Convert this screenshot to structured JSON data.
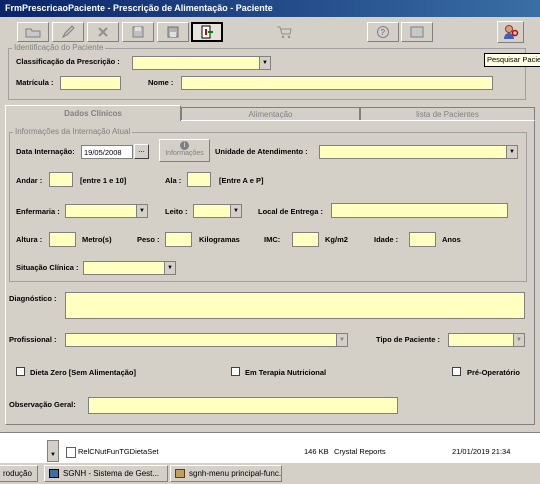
{
  "window": {
    "title": "FrmPrescricaoPaciente - Prescrição de Alimentação - Paciente"
  },
  "toolbar": {
    "tooltip": "Pesquisar Paciente"
  },
  "identificacao": {
    "group_title": "Identificação do Paciente",
    "classificacao_label": "Classificação da Prescrição :",
    "classificacao_value": "",
    "matricula_label": "Matrícula :",
    "matricula_value": "",
    "nome_label": "Nome :",
    "nome_value": ""
  },
  "tabs": [
    {
      "label": "Dados Clínicos"
    },
    {
      "label": "Alimentação"
    },
    {
      "label": "lista de Pacientes"
    }
  ],
  "internacao": {
    "group_title": "Informações da Internação Atual",
    "data_label": "Data Internação:",
    "data_value": "19/05/2008",
    "dots_button": "...",
    "info_button": "Informações",
    "unidade_label": "Unidade de Atendimento :",
    "andar_label": "Andar :",
    "andar_hint": "[entre 1 e 10]",
    "ala_label": "Ala :",
    "ala_hint": "[Entre A e P]",
    "enfermaria_label": "Enfermaria :",
    "leito_label": "Leito :",
    "local_label": "Local de Entrega :",
    "altura_label": "Altura :",
    "altura_unit": "Metro(s)",
    "peso_label": "Peso :",
    "peso_unit": "Kilogramas",
    "imc_label": "IMC:",
    "imc_unit": "Kg/m2",
    "idade_label": "Idade :",
    "idade_unit": "Anos",
    "situacao_label": "Situação Clínica :"
  },
  "clinico": {
    "diagnostico_label": "Diagnóstico :",
    "profissional_label": "Profissional :",
    "tipo_paciente_label": "Tipo de Paciente :",
    "dieta_zero_label": "Dieta Zero [Sem Alimentação]",
    "terapia_label": "Em Terapia Nutricional",
    "pre_operatorio_label": "Pré-Operatório",
    "observacao_label": "Observação Geral:"
  },
  "background_files": [
    {
      "name": "RelCNutFunTGDietaSet",
      "size": "146 KB",
      "type": "Crystal Reports",
      "date": "21/01/2019 21:34"
    }
  ],
  "taskbar": {
    "items": [
      {
        "label": "rodução"
      },
      {
        "label": "SGNH - Sistema de Gest..."
      },
      {
        "label": "sgnh-menu principal-func..."
      }
    ]
  }
}
